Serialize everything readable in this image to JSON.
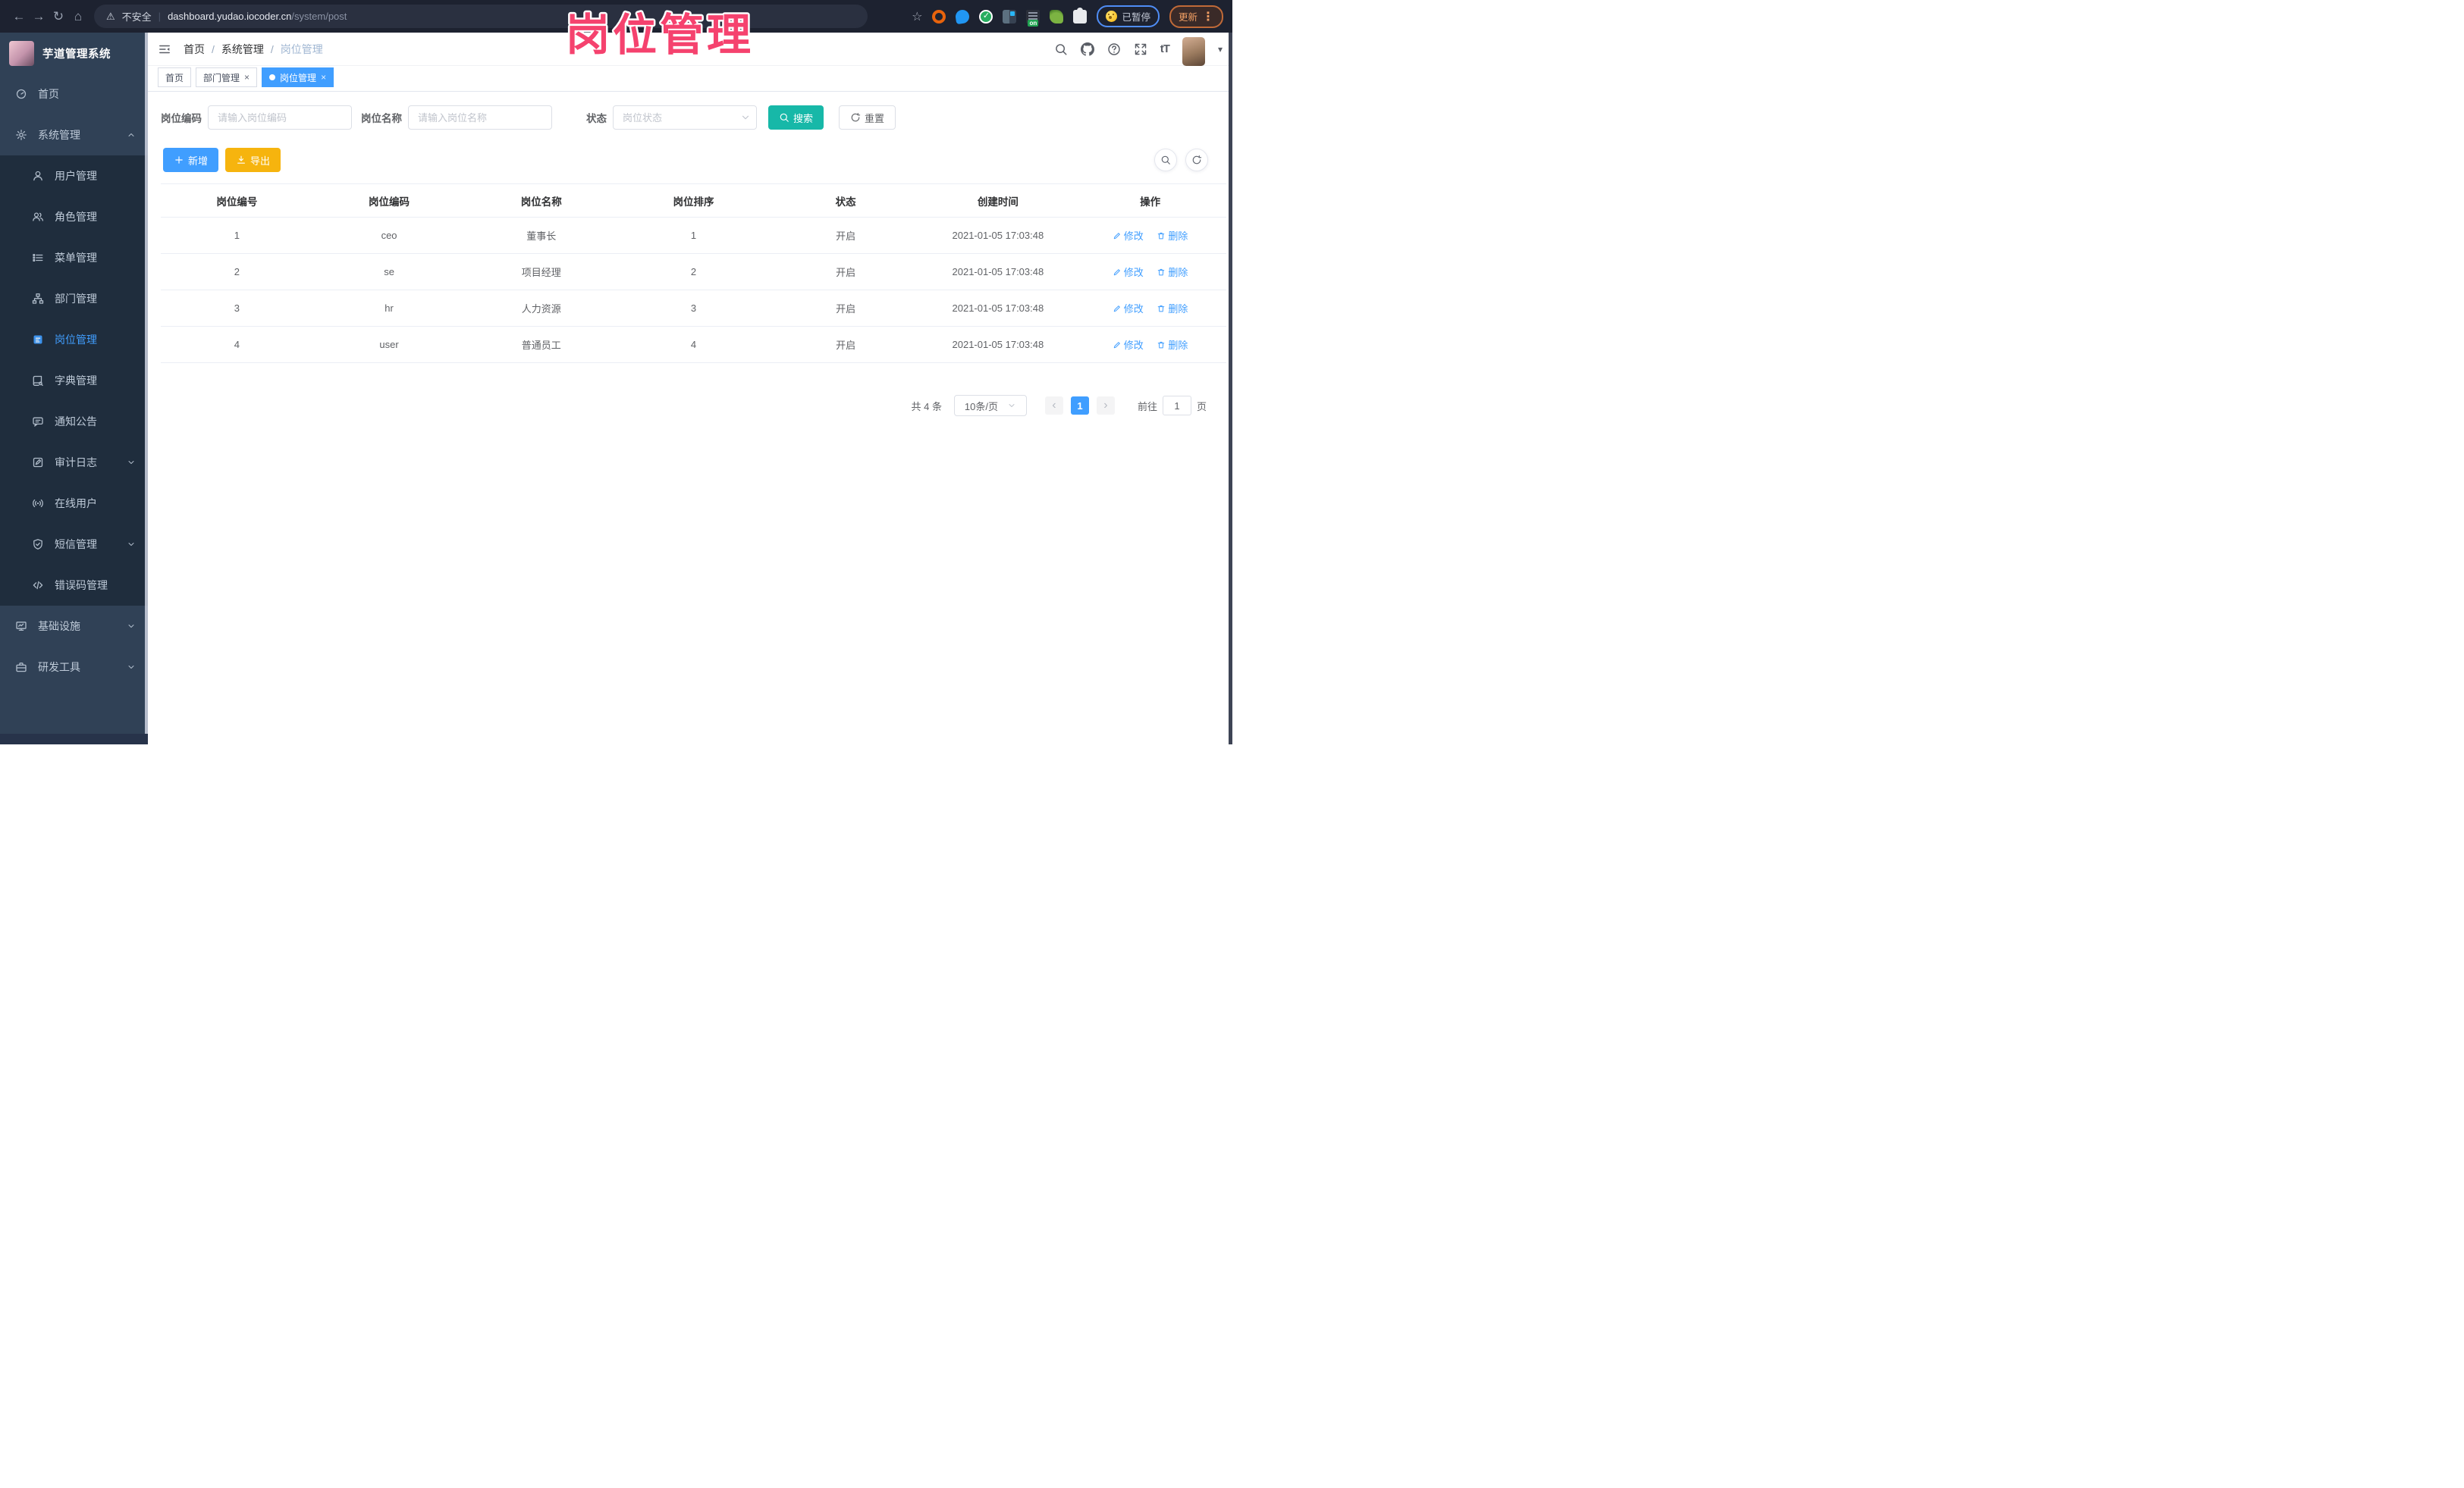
{
  "colors": {
    "accent_blue": "#409eff",
    "search_teal": "#17b8a8",
    "export_amber": "#f6b40e",
    "overlay_pink": "#f5426e",
    "sidebar_bg": "#304156",
    "submenu_bg": "#1f2d3d",
    "link_blue": "#409eff"
  },
  "icons": {
    "back": "←",
    "forward": "→",
    "reload": "↻",
    "home": "⌂",
    "warning": "⚠",
    "divider": "|",
    "star": "☆",
    "more": "⋮",
    "ext_on": "on",
    "font_size": "tT",
    "caret_down": "▾",
    "breadcrumb_sep": "/",
    "close": "×",
    "prev": "‹",
    "next": "›"
  },
  "browser": {
    "security_label": "不安全",
    "url_host": "dashboard.yudao.iocoder.cn",
    "url_path": "/system/post",
    "paused_label": "已暂停",
    "update_label": "更新"
  },
  "overlay": {
    "title": "岗位管理"
  },
  "sidebar": {
    "logo_title": "芋道管理系统",
    "items": [
      {
        "label": "首页",
        "icon": "dashboard-icon"
      },
      {
        "label": "系统管理",
        "icon": "gear-icon",
        "state": "expanded"
      },
      {
        "label": "用户管理",
        "icon": "user-icon"
      },
      {
        "label": "角色管理",
        "icon": "users-icon"
      },
      {
        "label": "菜单管理",
        "icon": "menu-list-icon"
      },
      {
        "label": "部门管理",
        "icon": "org-tree-icon"
      },
      {
        "label": "岗位管理",
        "icon": "post-badge-icon",
        "active": true
      },
      {
        "label": "字典管理",
        "icon": "dictionary-icon"
      },
      {
        "label": "通知公告",
        "icon": "announcement-icon"
      },
      {
        "label": "审计日志",
        "icon": "audit-log-icon",
        "state": "collapsed"
      },
      {
        "label": "在线用户",
        "icon": "online-users-icon"
      },
      {
        "label": "短信管理",
        "icon": "sms-shield-icon",
        "state": "collapsed"
      },
      {
        "label": "错误码管理",
        "icon": "error-code-icon"
      },
      {
        "label": "基础设施",
        "icon": "infrastructure-icon",
        "state": "collapsed"
      },
      {
        "label": "研发工具",
        "icon": "dev-tools-icon",
        "state": "collapsed"
      }
    ]
  },
  "header": {
    "breadcrumb": [
      "首页",
      "系统管理",
      "岗位管理"
    ]
  },
  "tabs": [
    {
      "label": "首页"
    },
    {
      "label": "部门管理"
    },
    {
      "label": "岗位管理",
      "active": true
    }
  ],
  "filters": {
    "post_code_label": "岗位编码",
    "post_code_placeholder": "请输入岗位编码",
    "post_name_label": "岗位名称",
    "post_name_placeholder": "请输入岗位名称",
    "status_label": "状态",
    "status_placeholder": "岗位状态",
    "search_label": "搜索",
    "reset_label": "重置"
  },
  "toolbar": {
    "add_label": "新增",
    "export_label": "导出"
  },
  "table": {
    "columns": [
      "岗位编号",
      "岗位编码",
      "岗位名称",
      "岗位排序",
      "状态",
      "创建时间",
      "操作"
    ],
    "edit_label": "修改",
    "delete_label": "删除",
    "rows": [
      {
        "id": "1",
        "code": "ceo",
        "name": "董事长",
        "sort": "1",
        "status": "开启",
        "created": "2021-01-05 17:03:48"
      },
      {
        "id": "2",
        "code": "se",
        "name": "项目经理",
        "sort": "2",
        "status": "开启",
        "created": "2021-01-05 17:03:48"
      },
      {
        "id": "3",
        "code": "hr",
        "name": "人力资源",
        "sort": "3",
        "status": "开启",
        "created": "2021-01-05 17:03:48"
      },
      {
        "id": "4",
        "code": "user",
        "name": "普通员工",
        "sort": "4",
        "status": "开启",
        "created": "2021-01-05 17:03:48"
      }
    ]
  },
  "pagination": {
    "total_text": "共 4 条",
    "page_size": "10条/页",
    "current_page": "1",
    "goto_label": "前往",
    "goto_value": "1",
    "unit_label": "页"
  }
}
